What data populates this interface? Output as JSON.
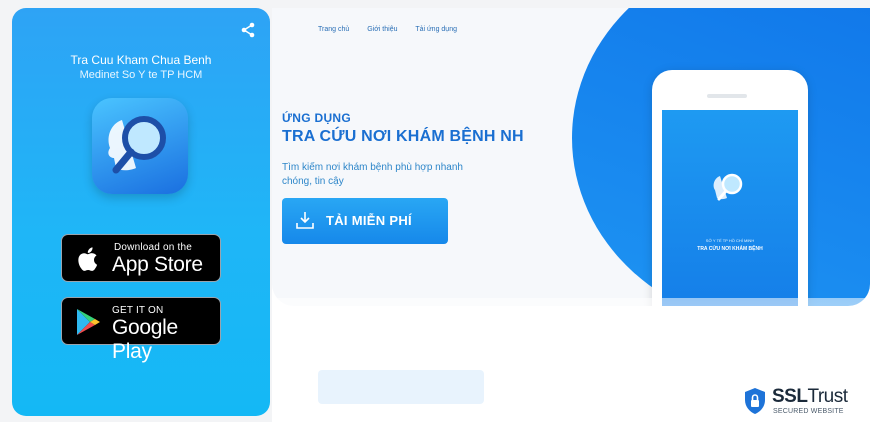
{
  "left_panel": {
    "app_title": "Tra Cuu Kham Chua Benh",
    "app_subtitle": "Medinet So Y te TP HCM",
    "share_icon": "share-icon",
    "app_icon": "magnifier-head-icon",
    "app_store": {
      "small": "Download on the",
      "big": "App Store",
      "icon": "apple-icon"
    },
    "google_play": {
      "small": "GET IT ON",
      "big": "Google Play",
      "icon": "play-triangle-icon"
    }
  },
  "site": {
    "nav": [
      "Trang chủ",
      "Giới thiệu",
      "Tải ứng dụng"
    ],
    "heading_small": "ỨNG DỤNG",
    "heading_big": "TRA CỨU NƠI KHÁM BỆNH   NH",
    "description": "Tìm kiếm nơi khám bệnh phù hợp nhanh chóng, tin cậy",
    "download_label": "TẢI MIỄN PHÍ",
    "phone_screen": {
      "line1": "SỞ Y TẾ TP HỒ CHÍ MINH",
      "line2": "TRA CỨU NƠI KHÁM BỆNH"
    }
  },
  "badge": {
    "name_bold": "SSL",
    "name_light": "Trust",
    "tagline": "SECURED WEBSITE"
  },
  "colors": {
    "panel_blue": "#1fb6f7",
    "brand_blue": "#1a6fd1",
    "button_blue": "#1e95f3"
  }
}
